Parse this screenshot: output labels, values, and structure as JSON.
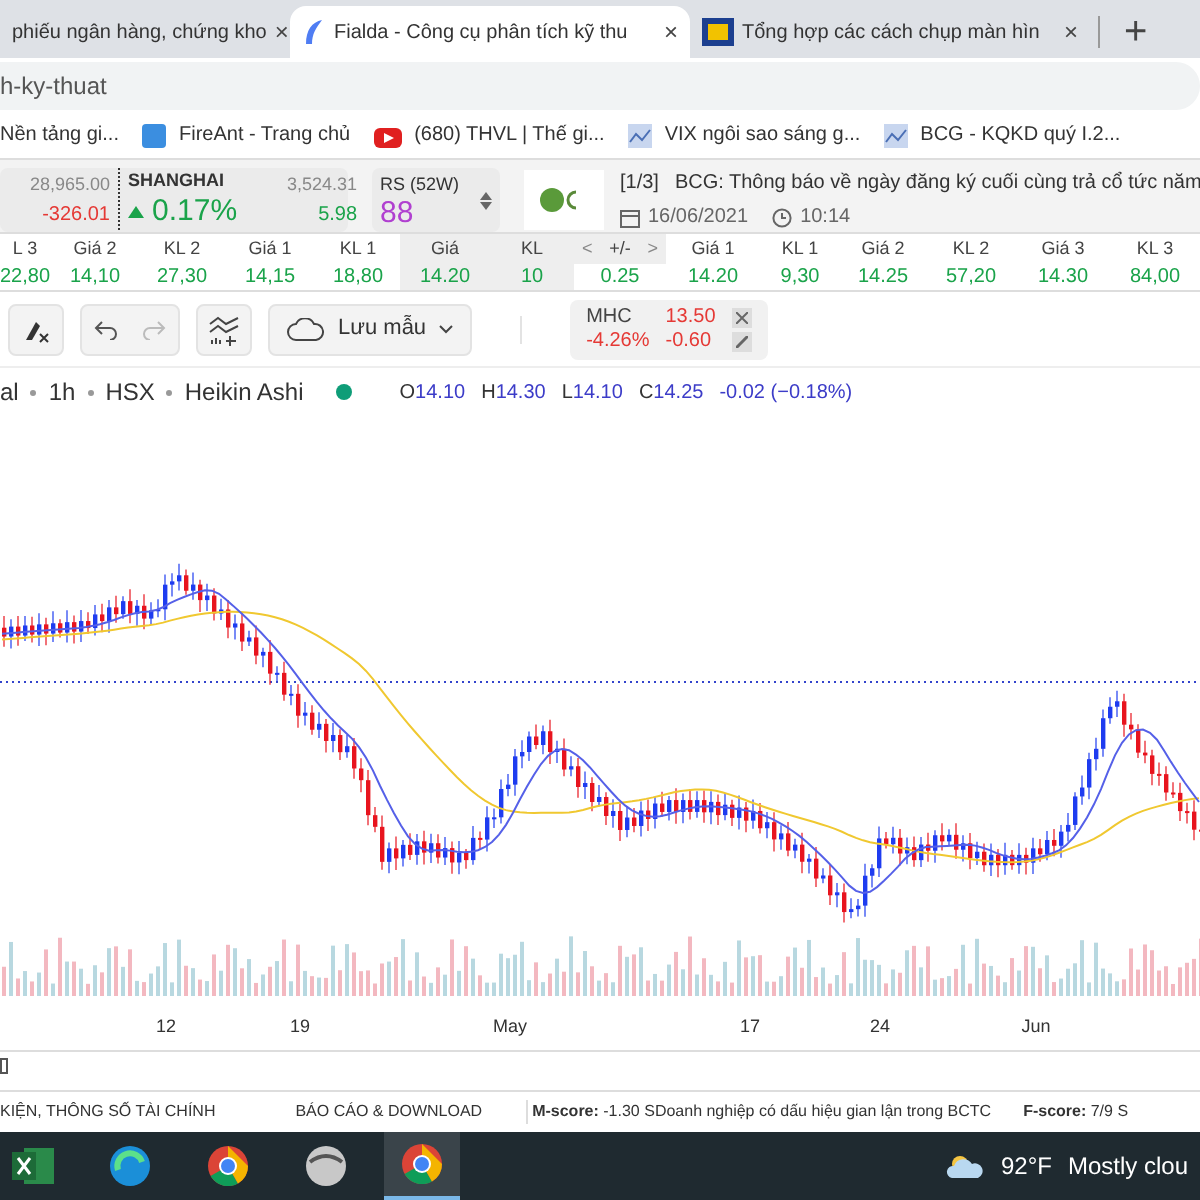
{
  "browser": {
    "tabs": [
      {
        "title": "phiếu ngân hàng, chứng kho",
        "selected": false,
        "close": "×"
      },
      {
        "title": "Fialda - Công cụ phân tích kỹ thu",
        "selected": true,
        "close": "×"
      },
      {
        "title": "Tổng hợp các cách chụp màn hìn",
        "selected": false,
        "close": "×"
      }
    ],
    "new_tab": "+",
    "address": "h-ky-thuat",
    "bookmarks": [
      "Nền tảng gi...",
      "FireAnt - Trang chủ",
      "(680) THVL | Thế gi...",
      "VIX ngôi sao sáng g...",
      "BCG - KQKD quý I.2..."
    ]
  },
  "market": {
    "index_value": "28,965.00",
    "index_change": "-326.01",
    "name": "SHANGHAI",
    "percent": "0.17%",
    "value": "3,524.31",
    "change": "5.98"
  },
  "rs": {
    "label": "RS (52W)",
    "value": "88"
  },
  "news": {
    "counter": "[1/3]",
    "headline": "BCG: Thông báo về ngày đăng ký cuối cùng trả cổ tức năm",
    "date": "16/06/2021",
    "time": "10:14"
  },
  "order_book": {
    "columns": [
      "L 3",
      "Giá 2",
      "KL 2",
      "Giá 1",
      "KL 1",
      "Giá",
      "KL",
      "+/-",
      "Giá 1",
      "KL 1",
      "Giá 2",
      "KL 2",
      "Giá 3",
      "KL 3"
    ],
    "values": [
      "22,80",
      "14,10",
      "27,30",
      "14,15",
      "18,80",
      "14.20",
      "10",
      "0.25",
      "14.20",
      "9,30",
      "14.25",
      "57,20",
      "14.30",
      "84,00"
    ],
    "prev": "<",
    "next": ">"
  },
  "toolbar": {
    "save_template": "Lưu mẫu"
  },
  "watch": {
    "symbol": "MHC",
    "price": "13.50",
    "percent": "-4.26%",
    "change": "-0.60"
  },
  "legend": {
    "parts": [
      "al",
      "1h",
      "HSX",
      "Heikin Ashi"
    ],
    "ohlc": [
      {
        "label": "O",
        "value": "14.10"
      },
      {
        "label": "H",
        "value": "14.30"
      },
      {
        "label": "L",
        "value": "14.10"
      },
      {
        "label": "C",
        "value": "14.25"
      }
    ],
    "change": "-0.02 (−0.18%)"
  },
  "x_labels": [
    "12",
    "19",
    "May",
    "17",
    "24",
    "Jun"
  ],
  "bottom_tabs": [
    "KIỆN, THÔNG SỐ TÀI CHÍNH",
    "BÁO CÁO & DOWNLOAD"
  ],
  "scores": [
    "**M-score:**  -1.30 SDoanh nghiệp có dấu hiệu gian lận trong BCTC",
    "**F-score:**  7/9 S"
  ],
  "taskbar": {
    "temperature": "92°F",
    "weather": "Mostly clou"
  }
}
